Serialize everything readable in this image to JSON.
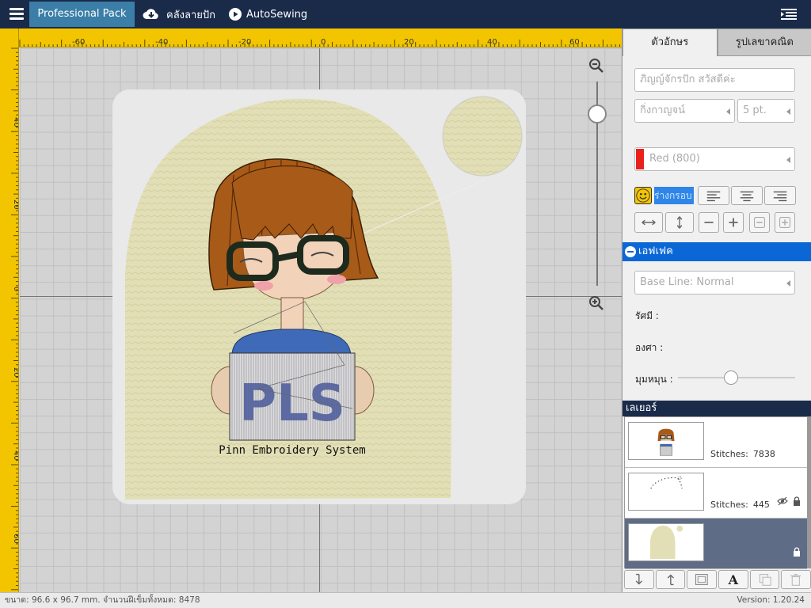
{
  "topbar": {
    "pack_label": "Professional Pack",
    "library_label": "คลังลายปัก",
    "autosewing_label": "AutoSewing"
  },
  "ruler": {
    "top_labels": [
      "-60",
      "-40",
      "-20",
      "0",
      "20",
      "40",
      "60"
    ],
    "left_labels": [
      "40",
      "20",
      "0",
      "20",
      "40",
      "60"
    ]
  },
  "design": {
    "caption": "Pinn Embroidery System",
    "sign_text": "PLS"
  },
  "panel": {
    "tabs": [
      "ตัวอักษร",
      "รูปเลขาคณิต"
    ],
    "text_input_placeholder": "ภิญญ์จักรปัก สวัสดีค่ะ",
    "font_name": "กิ่งกาญจน์",
    "font_size": "5 pt.",
    "thread_color": "Red (800)",
    "shape_label": "ร่างกรอบ",
    "effect_section": "เอฟเฟค",
    "baseline": "Base Line: Normal",
    "radius_label": "รัศมี :",
    "degree_label": "องศา :",
    "rotate_label": "มุมหมุน :",
    "rotate_value": 0.45
  },
  "layers": {
    "title": "เลเยอร์",
    "items": [
      {
        "stitches_label": "Stitches:",
        "stitches": "7838"
      },
      {
        "stitches_label": "Stitches:",
        "stitches": "445"
      },
      {
        "stitches_label": "",
        "stitches": ""
      }
    ]
  },
  "status": {
    "left": "ขนาด: 96.6 x 96.7 mm.  จำนวนฝีเข็มทั้งหมด: 8478",
    "right": "Version: 1.20.24"
  },
  "colors": {
    "topbar": "#1a2b4a",
    "accent": "#0b67d6",
    "ruler": "#f2c500",
    "fabric": "#e2dfb6"
  }
}
